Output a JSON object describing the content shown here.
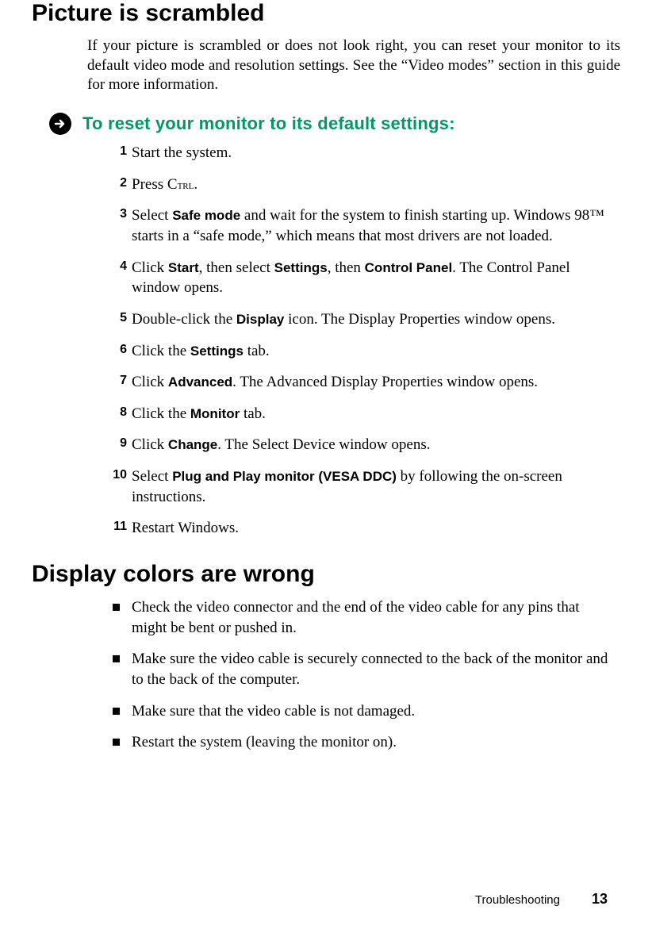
{
  "h1a": "Picture is scrambled",
  "intro_a": "If your picture is scrambled or does not look right, you can reset your monitor to its default video mode and resolution settings. See the “Video modes” section in this guide for more information.",
  "proc_title": "To reset your monitor to its default settings:",
  "steps": {
    "s1": "Start the system.",
    "s2_a": "Press ",
    "s2_ctrl_c": "C",
    "s2_ctrl_rest": "trl",
    "s2_b": ".",
    "s3_a": "Select ",
    "s3_safe": "Safe mode",
    "s3_b": " and wait for the system to finish starting up. Windows 98™ starts in a “safe mode,” which means that most drivers are not loaded.",
    "s4_a": "Click ",
    "s4_start": "Start",
    "s4_b": ", then select ",
    "s4_settings": "Settings",
    "s4_c": ", then ",
    "s4_cp": "Control Panel",
    "s4_d": ". The Control Panel window opens.",
    "s5_a": "Double-click the ",
    "s5_display": "Display",
    "s5_b": " icon. The Display Properties window opens.",
    "s6_a": "Click the ",
    "s6_settings": "Settings",
    "s6_b": " tab.",
    "s7_a": "Click ",
    "s7_adv": "Advanced",
    "s7_b": ". The Advanced Display Properties window opens.",
    "s8_a": "Click the ",
    "s8_mon": "Monitor",
    "s8_b": " tab.",
    "s9_a": "Click ",
    "s9_change": "Change",
    "s9_b": ". The Select Device window opens.",
    "s10_a": "Select ",
    "s10_pnp": "Plug and Play monitor (VESA DDC)",
    "s10_b": " by following the on-screen instructions.",
    "s11": "Restart Windows."
  },
  "h1b": "Display colors are wrong",
  "bullets": {
    "b1": "Check the video connector and the end of the video cable for any pins that might be bent or pushed in.",
    "b2": "Make sure the video cable is securely connected to the back of the monitor and to the back of the computer.",
    "b3": "Make sure that the video cable is not damaged.",
    "b4": "Restart the system (leaving the monitor on)."
  },
  "footer_label": "Troubleshooting",
  "footer_page": "13"
}
